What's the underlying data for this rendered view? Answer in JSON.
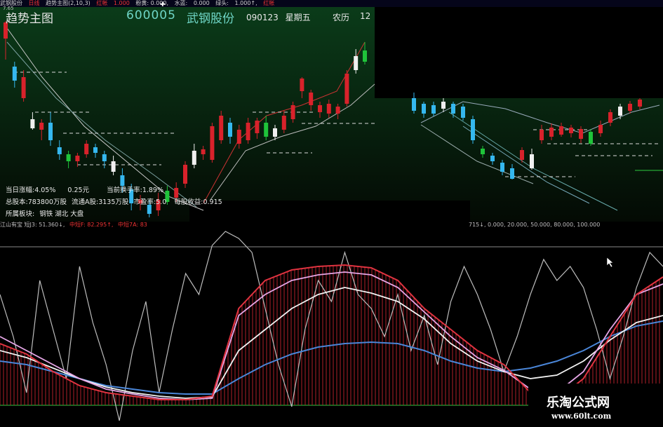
{
  "topbar": {
    "items": [
      "武钢股份",
      "日线",
      "趋势主图(2,10,3)",
      "红帐",
      "1.000",
      "粉黄: 0.000,",
      "水蓝:",
      "0.000",
      "绿头:",
      "1.000↑,",
      "红帐"
    ],
    "small_value": "7.65"
  },
  "header": {
    "title": "趋势主图",
    "stock_code": "600005",
    "stock_name": "武钢股份",
    "date": "090123",
    "weekday": "星期五",
    "lunar": "农历",
    "lunar_num": "12"
  },
  "info": {
    "change_label": "当日涨幅:",
    "change_pct": "4.05%",
    "change_amt": "0.25元",
    "turnover_label": "当前换手率:",
    "turnover": "1.89%",
    "total_shares_label": "总股本:",
    "total_shares": "783800万股",
    "float_label": "流通A股:",
    "float_shares": "3135",
    "float_suffix": "万股",
    "pe_label": "市盈率:",
    "pe": "5.0",
    "eps_label": "每股收益:",
    "eps": "0.915",
    "sector_label": "所属板块:",
    "sector": "钢铁  湖北  大盘"
  },
  "lower_bar": {
    "left_text": "江山有宝  短J3: 51.360↓,",
    "mid1": "中短F: 82.295↑,",
    "mid2": "中短7A: 83",
    "right_text": "715↓, 0.000, 20.000, 50.000, 80.000, 100.000"
  },
  "watermark": {
    "line1": "乐淘公式网",
    "line2": "www.60lt.com"
  },
  "colors": {
    "up": "#d8222b",
    "down": "#35b8ef",
    "white": "#f0f0f0",
    "green": "#1fc43a",
    "pink": "#e080e0"
  },
  "chart_data": {
    "type": "candlestick",
    "candles": [
      {
        "o": 55,
        "c": 32,
        "h": 30,
        "l": 85
      },
      {
        "o": 95,
        "c": 115,
        "h": 88,
        "l": 125
      },
      {
        "o": 140,
        "c": 110,
        "h": 100,
        "l": 145
      },
      {
        "o": 170,
        "c": 183,
        "h": 160,
        "l": 185
      },
      {
        "o": 185,
        "c": 175,
        "h": 170,
        "l": 200
      },
      {
        "o": 175,
        "c": 200,
        "h": 160,
        "l": 208
      },
      {
        "o": 210,
        "c": 220,
        "h": 200,
        "l": 228
      },
      {
        "o": 220,
        "c": 230,
        "h": 215,
        "l": 240
      },
      {
        "o": 230,
        "c": 222,
        "h": 218,
        "l": 238
      },
      {
        "o": 220,
        "c": 205,
        "h": 200,
        "l": 225
      },
      {
        "o": 210,
        "c": 218,
        "h": 205,
        "l": 225
      },
      {
        "o": 220,
        "c": 230,
        "h": 215,
        "l": 240
      },
      {
        "o": 230,
        "c": 245,
        "h": 222,
        "l": 250
      },
      {
        "o": 250,
        "c": 265,
        "h": 240,
        "l": 275
      },
      {
        "o": 270,
        "c": 290,
        "h": 262,
        "l": 300
      },
      {
        "o": 290,
        "c": 285,
        "h": 278,
        "l": 300
      },
      {
        "o": 292,
        "c": 305,
        "h": 285,
        "l": 310
      },
      {
        "o": 300,
        "c": 285,
        "h": 275,
        "l": 308
      },
      {
        "o": 288,
        "c": 272,
        "h": 265,
        "l": 292
      },
      {
        "o": 282,
        "c": 268,
        "h": 260,
        "l": 288
      },
      {
        "o": 262,
        "c": 235,
        "h": 230,
        "l": 268
      },
      {
        "o": 235,
        "c": 215,
        "h": 205,
        "l": 240
      },
      {
        "o": 220,
        "c": 213,
        "h": 208,
        "l": 228
      },
      {
        "o": 228,
        "c": 180,
        "h": 175,
        "l": 232
      },
      {
        "o": 200,
        "c": 165,
        "h": 158,
        "l": 205
      },
      {
        "o": 175,
        "c": 195,
        "h": 168,
        "l": 205
      },
      {
        "o": 205,
        "c": 185,
        "h": 178,
        "l": 212
      },
      {
        "o": 200,
        "c": 175,
        "h": 168,
        "l": 205
      },
      {
        "o": 190,
        "c": 172,
        "h": 168,
        "l": 198
      },
      {
        "o": 175,
        "c": 195,
        "h": 165,
        "l": 200
      },
      {
        "o": 195,
        "c": 183,
        "h": 178,
        "l": 200
      },
      {
        "o": 185,
        "c": 165,
        "h": 158,
        "l": 190
      },
      {
        "o": 170,
        "c": 150,
        "h": 145,
        "l": 175
      },
      {
        "o": 130,
        "c": 112,
        "h": 110,
        "l": 140
      },
      {
        "o": 150,
        "c": 132,
        "h": 128,
        "l": 158
      },
      {
        "o": 160,
        "c": 150,
        "h": 145,
        "l": 168
      },
      {
        "o": 162,
        "c": 148,
        "h": 142,
        "l": 168
      },
      {
        "o": 162,
        "c": 152,
        "h": 148,
        "l": 170
      },
      {
        "o": 148,
        "c": 105,
        "h": 100,
        "l": 152
      },
      {
        "o": 100,
        "c": 80,
        "h": 70,
        "l": 105
      },
      {
        "o": 88,
        "c": 72,
        "h": 60,
        "l": 92
      }
    ],
    "candles_b": [
      {
        "o": 140,
        "c": 158,
        "h": 132,
        "l": 162
      },
      {
        "o": 148,
        "c": 162,
        "h": 145,
        "l": 168
      },
      {
        "o": 150,
        "c": 162,
        "h": 145,
        "l": 166
      },
      {
        "o": 145,
        "c": 155,
        "h": 140,
        "l": 160
      },
      {
        "o": 148,
        "c": 162,
        "h": 145,
        "l": 168
      },
      {
        "o": 152,
        "c": 168,
        "h": 148,
        "l": 172
      },
      {
        "o": 170,
        "c": 200,
        "h": 165,
        "l": 205
      },
      {
        "o": 212,
        "c": 220,
        "h": 208,
        "l": 225
      },
      {
        "o": 222,
        "c": 230,
        "h": 218,
        "l": 235
      },
      {
        "o": 232,
        "c": 245,
        "h": 228,
        "l": 250
      },
      {
        "o": 240,
        "c": 255,
        "h": 234,
        "l": 256
      },
      {
        "o": 228,
        "c": 214,
        "h": 210,
        "l": 232
      },
      {
        "o": 220,
        "c": 240,
        "h": 212,
        "l": 242
      },
      {
        "o": 200,
        "c": 185,
        "h": 178,
        "l": 205
      },
      {
        "o": 195,
        "c": 182,
        "h": 176,
        "l": 200
      },
      {
        "o": 192,
        "c": 180,
        "h": 175,
        "l": 195
      },
      {
        "o": 190,
        "c": 182,
        "h": 178,
        "l": 196
      },
      {
        "o": 198,
        "c": 184,
        "h": 180,
        "l": 204
      },
      {
        "o": 205,
        "c": 188,
        "h": 184,
        "l": 208
      },
      {
        "o": 190,
        "c": 178,
        "h": 172,
        "l": 195
      },
      {
        "o": 175,
        "c": 160,
        "h": 156,
        "l": 180
      },
      {
        "o": 165,
        "c": 152,
        "h": 148,
        "l": 170
      },
      {
        "o": 158,
        "c": 148,
        "h": 144,
        "l": 162
      },
      {
        "o": 152,
        "c": 142,
        "h": 140,
        "l": 156
      }
    ],
    "grey_line": [
      420,
      480,
      560,
      400,
      470,
      540,
      380,
      460,
      520,
      600,
      500,
      430,
      560,
      470,
      390,
      420,
      350,
      330,
      340,
      360,
      440,
      520,
      580,
      470,
      400,
      430,
      360,
      420,
      440,
      480,
      420,
      500,
      450,
      520,
      430,
      380,
      420,
      470,
      530,
      480,
      420,
      370,
      400,
      380,
      410,
      470,
      540,
      480,
      410,
      360,
      380
    ],
    "red_line": [
      490,
      505,
      530,
      550,
      560,
      565,
      570,
      570,
      565,
      440,
      400,
      385,
      380,
      378,
      382,
      400,
      440,
      470,
      500,
      520,
      560,
      570,
      540,
      480,
      420,
      395
    ],
    "pink_line": [
      480,
      500,
      520,
      540,
      555,
      562,
      568,
      570,
      568,
      450,
      420,
      400,
      392,
      388,
      392,
      410,
      445,
      480,
      510,
      528,
      555,
      560,
      530,
      470,
      420,
      405
    ],
    "white_line": [
      500,
      510,
      525,
      540,
      552,
      560,
      565,
      568,
      566,
      500,
      470,
      440,
      420,
      410,
      418,
      430,
      455,
      490,
      515,
      530,
      540,
      535,
      515,
      485,
      460,
      450
    ],
    "blue_line": [
      515,
      520,
      530,
      540,
      550,
      555,
      560,
      562,
      562,
      540,
      520,
      505,
      495,
      490,
      488,
      490,
      500,
      515,
      525,
      530,
      525,
      515,
      500,
      480,
      465,
      458
    ]
  }
}
